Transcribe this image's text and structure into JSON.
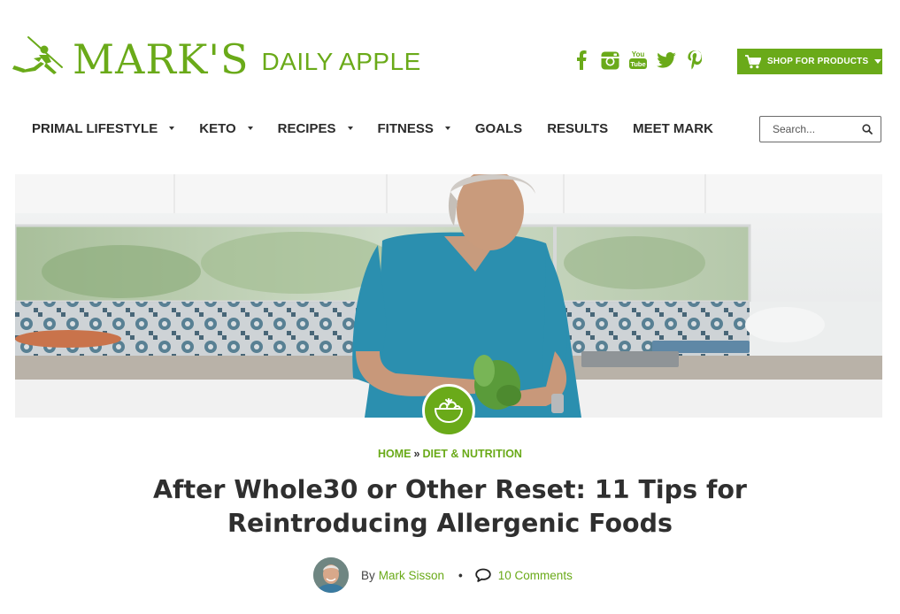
{
  "brand": {
    "name_main": "MARK'S",
    "name_sub": "DAILY APPLE",
    "color": "#6aaa19"
  },
  "social": [
    {
      "name": "facebook",
      "glyph": "f"
    },
    {
      "name": "instagram",
      "glyph": ""
    },
    {
      "name": "youtube",
      "glyph": "You Tube"
    },
    {
      "name": "twitter",
      "glyph": ""
    },
    {
      "name": "pinterest",
      "glyph": ""
    }
  ],
  "shop": {
    "label": "SHOP FOR PRODUCTS",
    "icon": "cart-icon"
  },
  "nav": {
    "items": [
      {
        "label": "PRIMAL LIFESTYLE",
        "dropdown": true
      },
      {
        "label": "KETO",
        "dropdown": true
      },
      {
        "label": "RECIPES",
        "dropdown": true
      },
      {
        "label": "FITNESS",
        "dropdown": true
      },
      {
        "label": "GOALS",
        "dropdown": false
      },
      {
        "label": "RESULTS",
        "dropdown": false
      },
      {
        "label": "MEET MARK",
        "dropdown": false
      }
    ]
  },
  "search": {
    "placeholder": "Search..."
  },
  "category_badge": {
    "icon": "salad-bowl-icon"
  },
  "breadcrumb": {
    "home": "HOME",
    "separator": "»",
    "category": "DIET & NUTRITION"
  },
  "article": {
    "title": "After Whole30 or Other Reset: 11 Tips for Reintroducing Allergenic Foods",
    "by_label": "By",
    "author": "Mark Sisson",
    "comments": "10 Comments"
  }
}
